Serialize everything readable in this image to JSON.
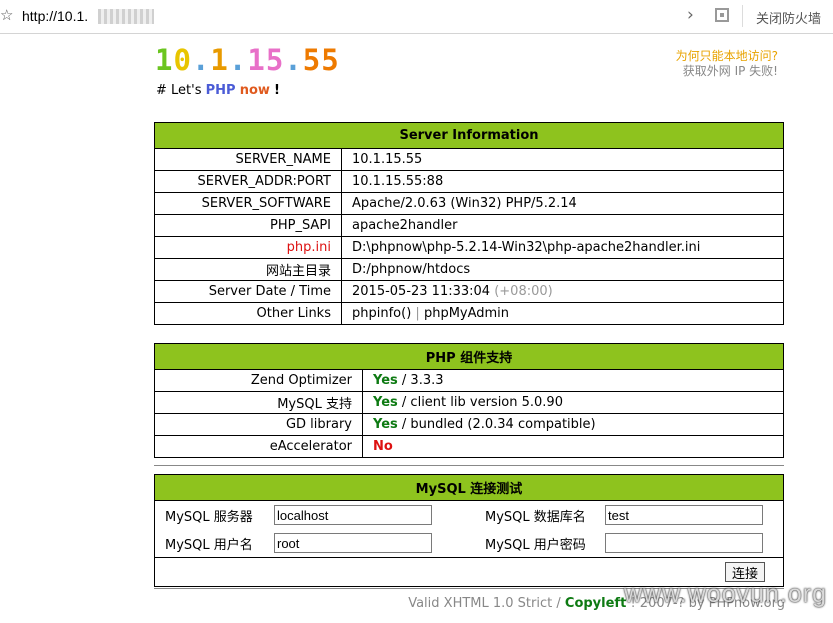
{
  "browser": {
    "url": "http://10.1.",
    "firewall_label": "关闭防火墙"
  },
  "header": {
    "logo_chars": [
      {
        "t": "1",
        "c": "#6bc520"
      },
      {
        "t": "0",
        "c": "#e8c500"
      },
      {
        "t": ".",
        "c": "#5aa0d8"
      },
      {
        "t": "1",
        "c": "#e89a00"
      },
      {
        "t": ".",
        "c": "#5aa0d8"
      },
      {
        "t": "1",
        "c": "#e870c8"
      },
      {
        "t": "5",
        "c": "#e870c8"
      },
      {
        "t": ".",
        "c": "#5aa0d8"
      },
      {
        "t": "5",
        "c": "#ee7a00"
      },
      {
        "t": "5",
        "c": "#ee7a00"
      }
    ],
    "tag_prefix": "# Let's ",
    "tag_php": "PHP",
    "tag_now": "now",
    "tag_bang": "!",
    "why_local": "为何只能本地访问?",
    "ip_fail": "获取外网 IP 失败!"
  },
  "server_info": {
    "title": "Server Information",
    "rows": [
      {
        "label": "SERVER_NAME",
        "value": "10.1.15.55"
      },
      {
        "label": "SERVER_ADDR:PORT",
        "value": "10.1.15.55:88"
      },
      {
        "label": "SERVER_SOFTWARE",
        "value": "Apache/2.0.63 (Win32) PHP/5.2.14"
      },
      {
        "label": "PHP_SAPI",
        "value": "apache2handler"
      },
      {
        "label": "php.ini",
        "value": "D:\\phpnow\\php-5.2.14-Win32\\php-apache2handler.ini"
      },
      {
        "label": "网站主目录",
        "value": "D:/phpnow/htdocs"
      }
    ],
    "date_label": "Server Date / Time",
    "date_value": "2015-05-23 11:33:04",
    "date_tz": "(+08:00)",
    "links_label": "Other Links",
    "link_phpinfo": "phpinfo()",
    "link_sep": "|",
    "link_pma": "phpMyAdmin"
  },
  "php_components": {
    "title": "PHP 组件支持",
    "rows": [
      {
        "label": "Zend Optimizer",
        "status": "Yes",
        "detail": "/ 3.3.3"
      },
      {
        "label": "MySQL 支持",
        "status": "Yes",
        "detail": "/ client lib version 5.0.90"
      },
      {
        "label": "GD library",
        "status": "Yes",
        "detail": "/ bundled (2.0.34 compatible)"
      },
      {
        "label": "eAccelerator",
        "status": "No",
        "detail": ""
      }
    ]
  },
  "mysql_test": {
    "title": "MySQL 连接测试",
    "server_label": "MySQL 服务器",
    "server_value": "localhost",
    "db_label": "MySQL 数据库名",
    "db_value": "test",
    "user_label": "MySQL 用户名",
    "user_value": "root",
    "pass_label": "MySQL 用户密码",
    "pass_value": "",
    "connect_label": "连接"
  },
  "footer": {
    "valid": "Valid XHTML 1.0 Strict",
    "slash": "/",
    "copyleft": "Copyleft",
    "rest": "! 2007-? by PHPnow.org",
    "watermark": "www.woovun.org"
  }
}
